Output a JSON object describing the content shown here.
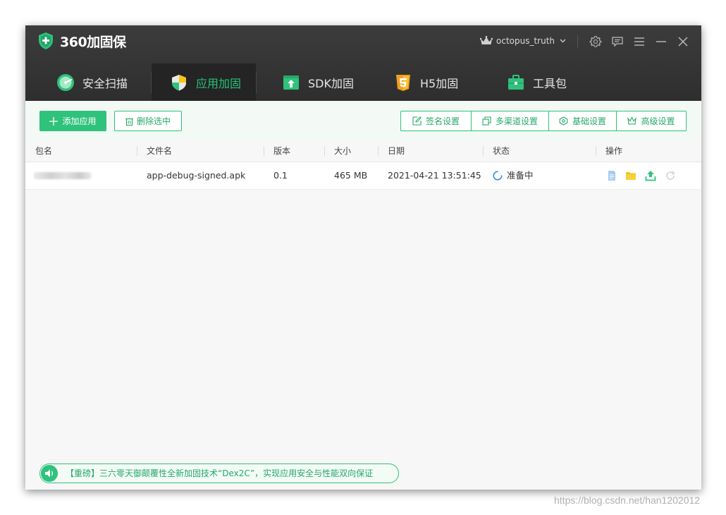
{
  "app": {
    "title": "360加固保"
  },
  "header": {
    "username": "octopus_truth"
  },
  "tabs": [
    {
      "label": "安全扫描",
      "icon": "scan-icon"
    },
    {
      "label": "应用加固",
      "icon": "shield-icon",
      "active": true
    },
    {
      "label": "SDK加固",
      "icon": "sdk-upload-icon"
    },
    {
      "label": "H5加固",
      "icon": "html5-icon"
    },
    {
      "label": "工具包",
      "icon": "toolbox-icon"
    }
  ],
  "toolbar": {
    "add_label": "添加应用",
    "delete_label": "删除选中",
    "settings": [
      "签名设置",
      "多渠道设置",
      "基础设置",
      "高级设置"
    ]
  },
  "table": {
    "columns": [
      "包名",
      "文件名",
      "版本",
      "大小",
      "日期",
      "状态",
      "操作"
    ],
    "rows": [
      {
        "filename": "app-debug-signed.apk",
        "version": "0.1",
        "size": "465 MB",
        "date": "2021-04-21 13:51:45",
        "status": "准备中"
      }
    ]
  },
  "notice": {
    "text": "【重磅】三六零天御颠覆性全新加固技术“Dex2C”，实现应用安全与性能双向保证"
  },
  "watermark": "https://blog.csdn.net/han1202012",
  "colors": {
    "accent": "#2fc27c",
    "header_bg": "#333333",
    "active_tab_bg": "#242424",
    "warning_yellow": "#f5c518"
  }
}
